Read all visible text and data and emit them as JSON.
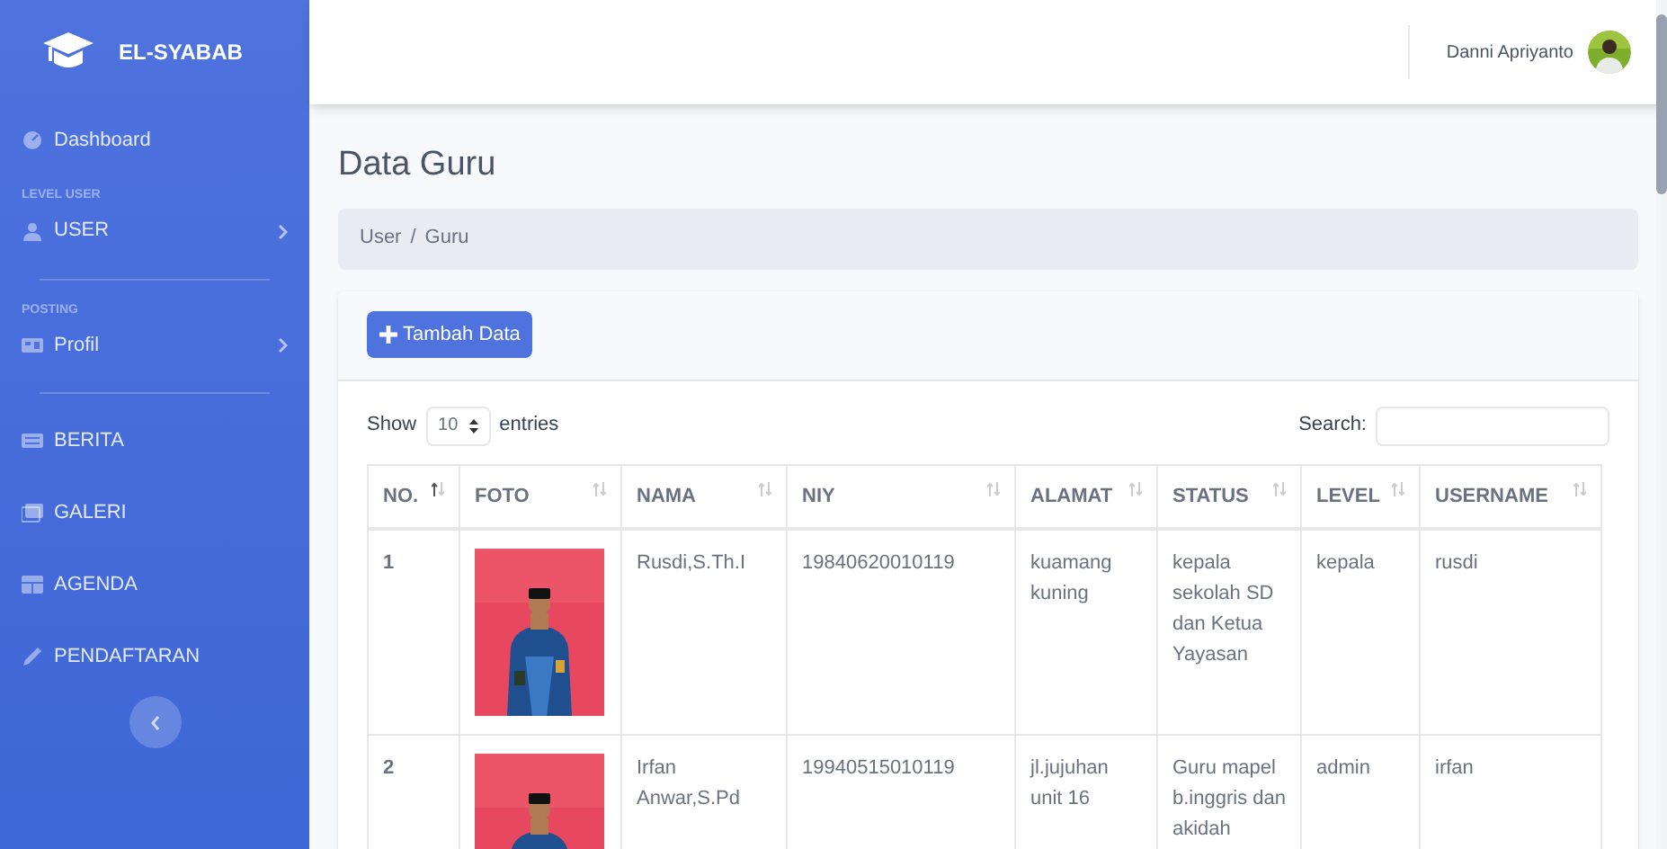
{
  "sidebar": {
    "brand": "EL-SYABAB",
    "items": [
      {
        "kind": "link",
        "label": "Dashboard"
      },
      {
        "kind": "heading",
        "label": "LEVEL USER"
      },
      {
        "kind": "submenu",
        "label": "USER"
      },
      {
        "kind": "divider"
      },
      {
        "kind": "heading",
        "label": "POSTING"
      },
      {
        "kind": "submenu",
        "label": "Profil"
      },
      {
        "kind": "divider"
      },
      {
        "kind": "link",
        "label": "BERITA"
      },
      {
        "kind": "link",
        "label": "GALERI"
      },
      {
        "kind": "link",
        "label": "AGENDA"
      },
      {
        "kind": "link",
        "label": "PENDAFTARAN"
      }
    ]
  },
  "topbar": {
    "user_name": "Danni Apriyanto"
  },
  "page": {
    "title": "Data Guru",
    "breadcrumb": [
      "User",
      "Guru"
    ],
    "breadcrumb_separator": "/"
  },
  "card": {
    "add_button": "Tambah Data",
    "length": {
      "before": "Show",
      "value": "10",
      "after": "entries"
    },
    "search": {
      "label": "Search:"
    },
    "table": {
      "columns": [
        {
          "label": "NO.",
          "sorted": true
        },
        {
          "label": "FOTO",
          "sorted": false
        },
        {
          "label": "NAMA",
          "sorted": false
        },
        {
          "label": "NIY",
          "sorted": false
        },
        {
          "label": "ALAMAT",
          "sorted": false
        },
        {
          "label": "STATUS",
          "sorted": false
        },
        {
          "label": "LEVEL",
          "sorted": false
        },
        {
          "label": "USERNAME",
          "sorted": false
        }
      ],
      "rows": [
        {
          "no": "1",
          "nama": "Rusdi,S.Th.I",
          "niy": "19840620010119",
          "alamat": "kuamang kuning",
          "status": "kepala sekolah SD dan Ketua Yayasan",
          "level": "kepala",
          "username": "rusdi"
        },
        {
          "no": "2",
          "nama": "Irfan Anwar,S.Pd",
          "niy": "19940515010119",
          "alamat": "jl.jujuhan unit 16",
          "status": "Guru mapel b.inggris dan akidah",
          "level": "admin",
          "username": "irfan"
        }
      ]
    }
  }
}
